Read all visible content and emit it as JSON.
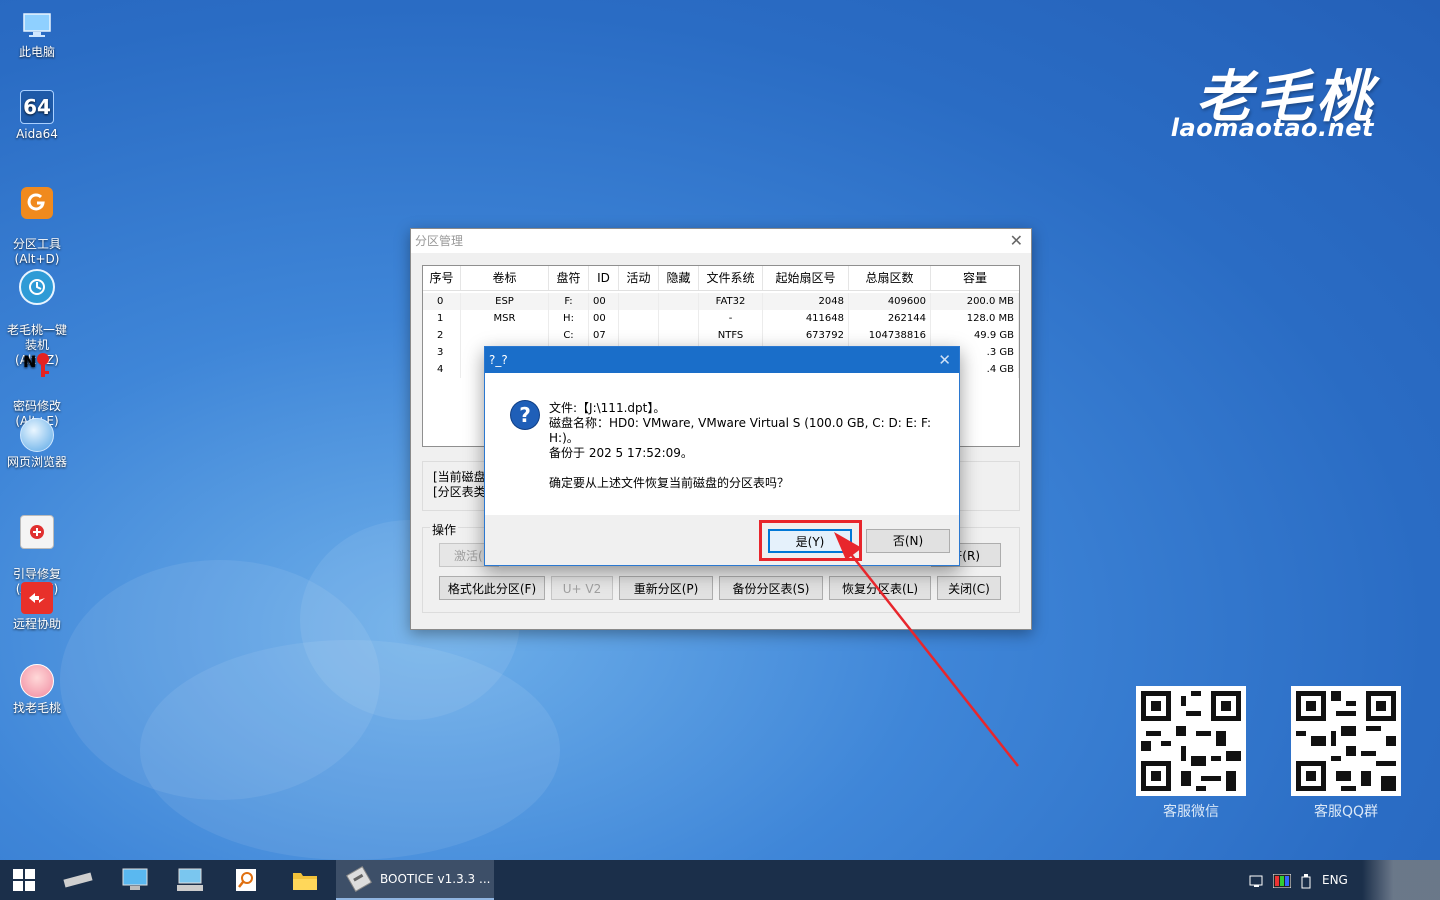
{
  "desktop_icons": [
    {
      "icon": "computer-icon",
      "label": "此电脑"
    },
    {
      "icon": "aida64-icon",
      "label": "Aida64",
      "glyph": "64"
    },
    {
      "icon": "partition-tool-icon",
      "label": "分区工具\n(Alt+D)"
    },
    {
      "icon": "one-key-install-icon",
      "label": "老毛桃一键\n装机(Alt+Z)"
    },
    {
      "icon": "password-modify-icon",
      "label": "密码修改\n(Alt+E)"
    },
    {
      "icon": "browser-icon",
      "label": "网页浏览器"
    },
    {
      "icon": "boot-repair-icon",
      "label": "引导修复\n(Alt+F)"
    },
    {
      "icon": "remote-assist-icon",
      "label": "远程协助"
    },
    {
      "icon": "find-laomaotao-icon",
      "label": "找老毛桃"
    }
  ],
  "brand": {
    "logo_text": "老毛桃",
    "url": "laomaotao.net"
  },
  "qr_codes": [
    {
      "label": "客服微信"
    },
    {
      "label": "客服QQ群"
    }
  ],
  "window": {
    "title": "分区管理",
    "table": {
      "headers": [
        "序号",
        "卷标",
        "盘符",
        "ID",
        "活动",
        "隐藏",
        "文件系统",
        "起始扇区号",
        "总扇区数",
        "容量"
      ],
      "rows": [
        [
          "0",
          "ESP",
          "F:",
          "00",
          "",
          "",
          "FAT32",
          "2048",
          "409600",
          "200.0 MB"
        ],
        [
          "1",
          "MSR",
          "H:",
          "00",
          "",
          "",
          "-",
          "411648",
          "262144",
          "128.0 MB"
        ],
        [
          "2",
          "",
          "C:",
          "07",
          "",
          "",
          "NTFS",
          "673792",
          "104738816",
          "49.9 GB"
        ],
        [
          "3",
          "",
          "",
          "",
          "",
          "",
          "",
          "",
          "",
          ".3 GB"
        ],
        [
          "4",
          "",
          "",
          "",
          "",
          "",
          "",
          "",
          "",
          ".4 GB"
        ]
      ]
    },
    "info_line1": "[当前磁盘",
    "info_line2": "[分区表类",
    "ops_label": "操作",
    "buttons_row1": {
      "activate": "激活(",
      "right": "符(R)"
    },
    "buttons_row2": [
      "格式化此分区(F)",
      "U+ V2",
      "重新分区(P)",
      "备份分区表(S)",
      "恢复分区表(L)",
      "关闭(C)"
    ]
  },
  "dialog": {
    "title": "?_?",
    "line_file": "文件:【J:\\111.dpt】。",
    "line_disk": "磁盘名称：HD0: VMware, VMware Virtual S (100.0 GB, C: D: E: F:",
    "line_disk2": "H:)。",
    "line_backup": "备份于 202     5 17:52:09。",
    "question": "确定要从上述文件恢复当前磁盘的分区表吗？",
    "yes_label": "是(Y)",
    "no_label": "否(N)"
  },
  "taskbar": {
    "active_app": "BOOTICE v1.3.3 ...",
    "lang": "ENG"
  },
  "colors": {
    "highlight": "#e8262c",
    "dialog_title": "#1a6ec9"
  }
}
